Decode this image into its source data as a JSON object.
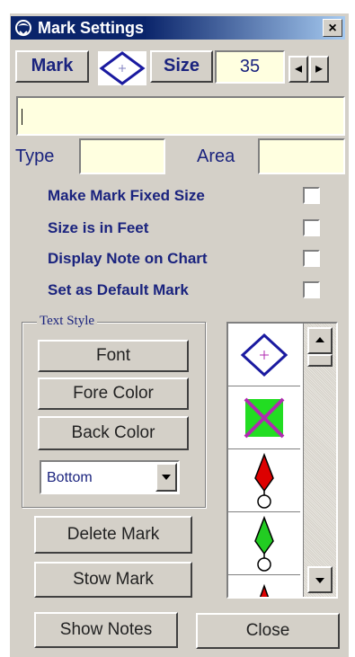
{
  "window": {
    "title": "Mark Settings",
    "close_glyph": "×"
  },
  "toolbar": {
    "mark_label": "Mark",
    "size_label": "Size",
    "size_value": "35",
    "prev_glyph": "◂",
    "next_glyph": "▸"
  },
  "note": {
    "value": ""
  },
  "type": {
    "label": "Type",
    "value": ""
  },
  "area": {
    "label": "Area",
    "value": ""
  },
  "options": [
    {
      "label": "Make Mark Fixed Size",
      "checked": false
    },
    {
      "label": "Size is in Feet",
      "checked": false
    },
    {
      "label": "Display Note on Chart",
      "checked": false
    },
    {
      "label": "Set as Default Mark",
      "checked": false
    }
  ],
  "text_style": {
    "title": "Text Style",
    "font_button": "Font",
    "fore_color_button": "Fore Color",
    "back_color_button": "Back Color",
    "position_select": "Bottom"
  },
  "actions": {
    "delete": "Delete Mark",
    "stow": "Stow Mark",
    "show_notes": "Show Notes",
    "close": "Close"
  },
  "mark_list": {
    "items": [
      "diamond-crosshair-icon",
      "x-box-icon",
      "red-buoy-icon",
      "green-buoy-icon",
      "red-buoy-partial-icon"
    ]
  },
  "colors": {
    "title_bar": "#0a246a",
    "field_bg": "#ffffe0",
    "label_text": "#1a237e",
    "mark_blue": "#1a1aa0",
    "mark_green": "#22dd22",
    "mark_purple": "#b02ab0",
    "buoy_red": "#dd0000",
    "buoy_green": "#22cc22"
  }
}
